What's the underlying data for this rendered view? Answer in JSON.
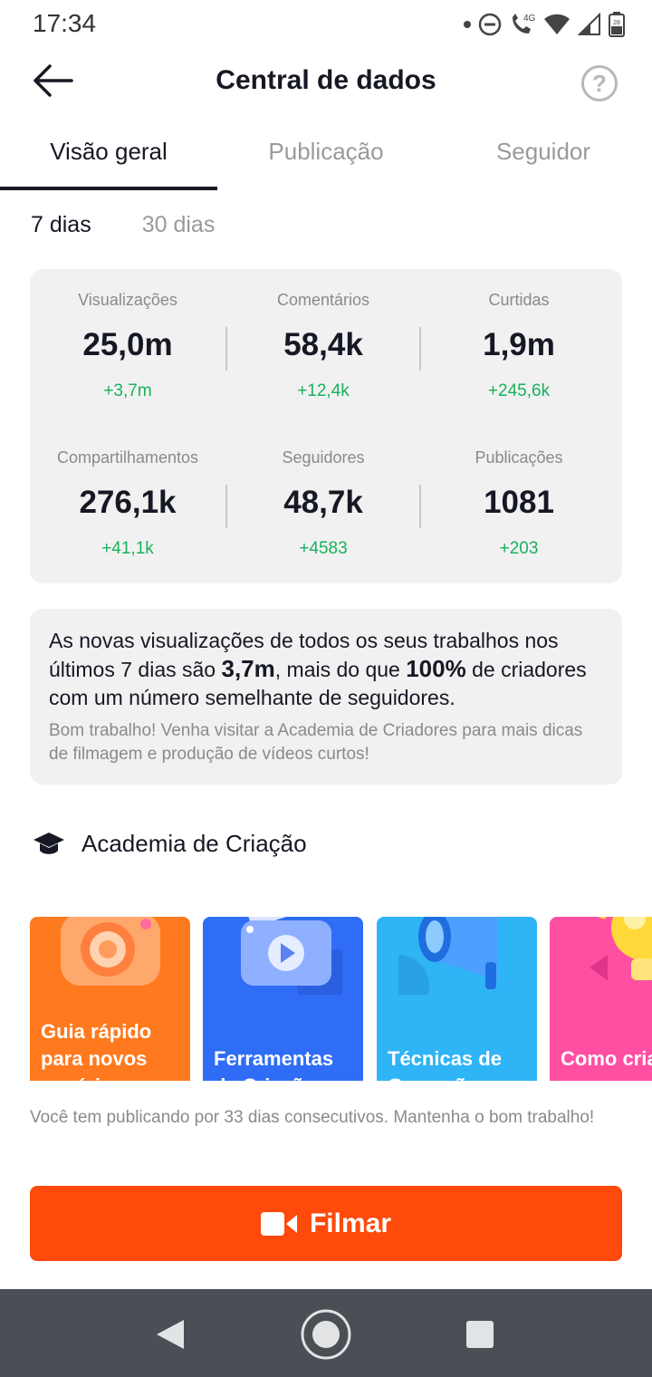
{
  "status_bar": {
    "time": "17:34",
    "network": "4G",
    "battery": "28"
  },
  "header": {
    "title": "Central de dados",
    "help_icon_text": "?"
  },
  "tabs": [
    {
      "label": "Visão geral",
      "active": true
    },
    {
      "label": "Publicação",
      "active": false
    },
    {
      "label": "Seguidor",
      "active": false
    }
  ],
  "period": {
    "options": [
      "7 dias",
      "30 dias"
    ],
    "selected": "7 dias"
  },
  "stats": [
    {
      "label": "Visualizações",
      "value": "25,0m",
      "delta": "+3,7m"
    },
    {
      "label": "Comentários",
      "value": "58,4k",
      "delta": "+12,4k"
    },
    {
      "label": "Curtidas",
      "value": "1,9m",
      "delta": "+245,6k"
    },
    {
      "label": "Compartilhamentos",
      "value": "276,1k",
      "delta": "+41,1k"
    },
    {
      "label": "Seguidores",
      "value": "48,7k",
      "delta": "+4583"
    },
    {
      "label": "Publicações",
      "value": "1081",
      "delta": "+203"
    }
  ],
  "insight": {
    "text_1": "As novas visualizações de todos os seus trabalhos nos últimos 7 dias são ",
    "highlight_1": "3,7m",
    "text_2": ", mais do que ",
    "highlight_2": "100%",
    "text_3": " de criadores com um número semelhante de seguidores.",
    "sub": "Bom trabalho! Venha visitar a Academia de Criadores para mais dicas de filmagem e produção de vídeos curtos!"
  },
  "academy": {
    "title": "Academia de Criação",
    "cards": [
      {
        "title": "Guia rápido para novos usuários",
        "color": "#ff7a1f",
        "icon": "camera-icon"
      },
      {
        "title": "Ferramentas de Criação",
        "color": "#2f6df6",
        "icon": "clapperboard-icon"
      },
      {
        "title": "Técnicas de Gravação",
        "color": "#2fb4f5",
        "icon": "megaphone-icon"
      },
      {
        "title": "Como criar personagens",
        "color": "#ff4fa3",
        "icon": "lightbulb-icon"
      }
    ]
  },
  "bottom": {
    "streak_text": "Você tem publicando por 33 dias consecutivos. Mantenha o bom trabalho!",
    "film_label": "Filmar",
    "film_color": "#fe4a0b"
  },
  "colors": {
    "positive": "#18b25a",
    "primary_text": "#161823",
    "muted_text": "#8a8a8e"
  }
}
